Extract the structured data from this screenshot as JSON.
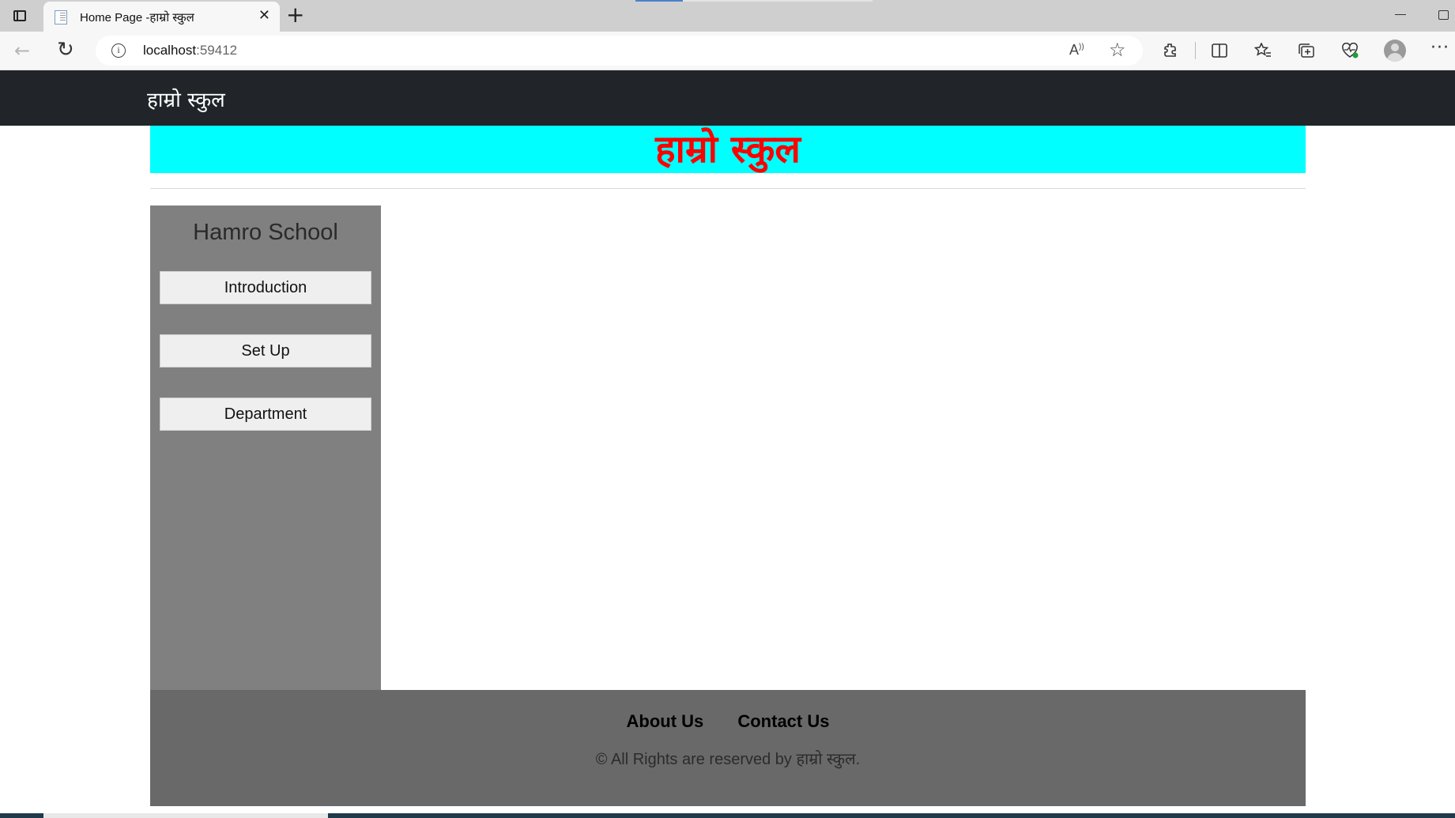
{
  "browser": {
    "tab_title": "Home Page -हाम्रो स्कुल",
    "tab_close": "✕",
    "new_tab": "+",
    "url_host": "localhost",
    "url_port": ":59412",
    "icons": {
      "back": "arrow-left-icon",
      "reload": "reload-icon",
      "info": "info-icon",
      "read_aloud": "read-aloud-icon",
      "favorite": "star-icon",
      "extensions": "extensions-icon",
      "split_screen": "split-screen-icon",
      "favorites": "favorites-icon",
      "collections": "collections-icon",
      "performance": "heartbeat-icon",
      "profile": "profile-icon",
      "more": "more-icon"
    }
  },
  "site": {
    "brand": "हाम्रो स्कुल",
    "hero_title": "हाम्रो स्कुल",
    "hero_bg": "#00ffff",
    "hero_color": "#ff0000"
  },
  "sidebar": {
    "title": "Hamro School",
    "items": [
      {
        "label": "Introduction"
      },
      {
        "label": "Set Up"
      },
      {
        "label": "Department"
      }
    ]
  },
  "footer": {
    "links": [
      {
        "label": "About Us"
      },
      {
        "label": "Contact Us"
      }
    ],
    "copyright": "© All Rights are reserved by हाम्रो स्कुल."
  }
}
